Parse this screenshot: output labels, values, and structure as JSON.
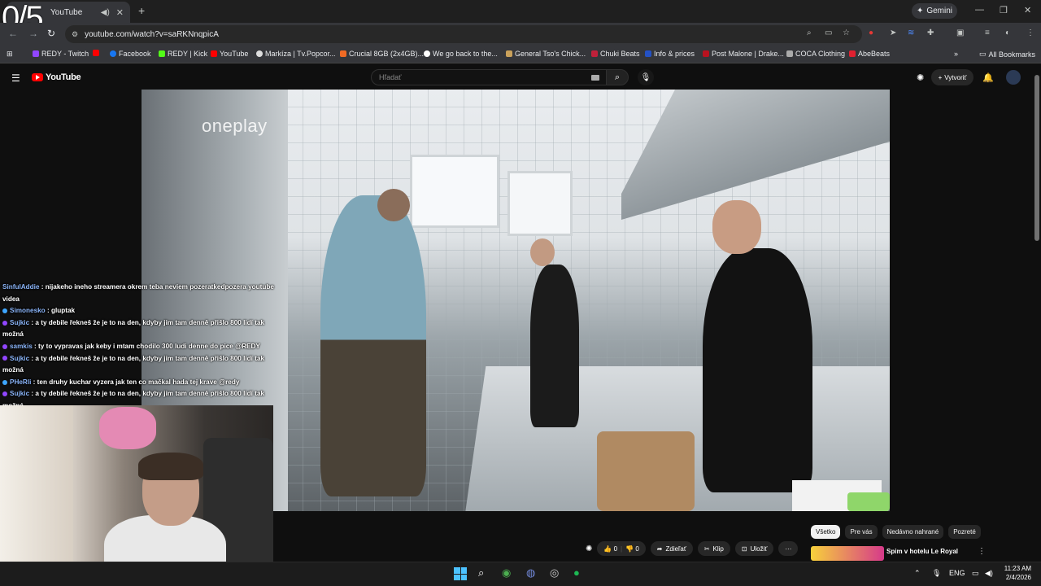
{
  "overlay": {
    "counter": "0/5"
  },
  "browser": {
    "tab_title": "YouTube",
    "url": "youtube.com/watch?v=saRKNnqpicA",
    "gemini_label": "Gemini",
    "bookmarks": [
      {
        "label": "REDY - Twitch",
        "color": "#9146ff"
      },
      {
        "label": "",
        "color": "#ff0000"
      },
      {
        "label": "Facebook",
        "color": "#1877f2"
      },
      {
        "label": "REDY | Kick",
        "color": "#53fc18"
      },
      {
        "label": "YouTube",
        "color": "#ff0000"
      },
      {
        "label": "Markíza | Tv.Popcor...",
        "color": "#dddddd"
      },
      {
        "label": "Crucial 8GB (2x4GB)...",
        "color": "#f06a24"
      },
      {
        "label": "We go back to the...",
        "color": "#ffffff"
      },
      {
        "label": "General Tso's Chick...",
        "color": "#c9a15b"
      },
      {
        "label": "Chuki Beats",
        "color": "#c0203a"
      },
      {
        "label": "Info & prices",
        "color": "#2451c4"
      },
      {
        "label": "Post Malone | Drake...",
        "color": "#b8121f"
      },
      {
        "label": "COCA Clothing",
        "color": "#aaaaaa"
      },
      {
        "label": "AbeBeats",
        "color": "#e02030"
      }
    ],
    "all_bookmarks": "All Bookmarks"
  },
  "youtube": {
    "logo": "YouTube",
    "search_placeholder": "Hľadať",
    "create_label": "Vytvoriť",
    "video_watermark": "oneplay",
    "actions": {
      "likes": "0",
      "dislikes": "0",
      "share": "Zdieľať",
      "clip": "Klip",
      "save": "Uložiť",
      "more": "···"
    },
    "chips": [
      "Všetko",
      "Pre vás",
      "Nedávno nahrané",
      "Pozreté"
    ],
    "recommended_title": "Spim v hotelu Le Royal"
  },
  "chat": [
    {
      "user": "SinfulAddie",
      "text": " : nijakeho ineho streamera okrem teba neviem pozeratkedpozera youtube videa",
      "badge": ""
    },
    {
      "user": "Simonesko",
      "text": " : gluptak",
      "badge": "#3ea6ff"
    },
    {
      "user": "Sujkic",
      "text": " : a ty debile řekneš že je to na den, kdyby jim tam denně přišlo 800 lidí tak možná",
      "badge": "#9146ff"
    },
    {
      "user": "samkis",
      "text": " : ty to vypravas jak keby i mtam chodilo 300 ludi denne do pice @REDY",
      "badge": "#9146ff"
    },
    {
      "user": "Sujkic",
      "text": " : a ty debile řekneš že je to na den, kdyby jim tam denně přišlo 800 lidí tak možná",
      "badge": "#9146ff"
    },
    {
      "user": "PHeRli",
      "text": " : ten druhy kuchar vyzera jak ten co mačkal hada tej krave @redy",
      "badge": "#3ea6ff"
    },
    {
      "user": "Sujkic",
      "text": " : a ty debile řekneš že je to na den, kdyby jim tam denně přišlo 800 lidí tak možná",
      "badge": "#9146ff"
    }
  ],
  "taskbar": {
    "lang": "ENG",
    "time": "11:23 AM",
    "date": "2/4/2026"
  }
}
